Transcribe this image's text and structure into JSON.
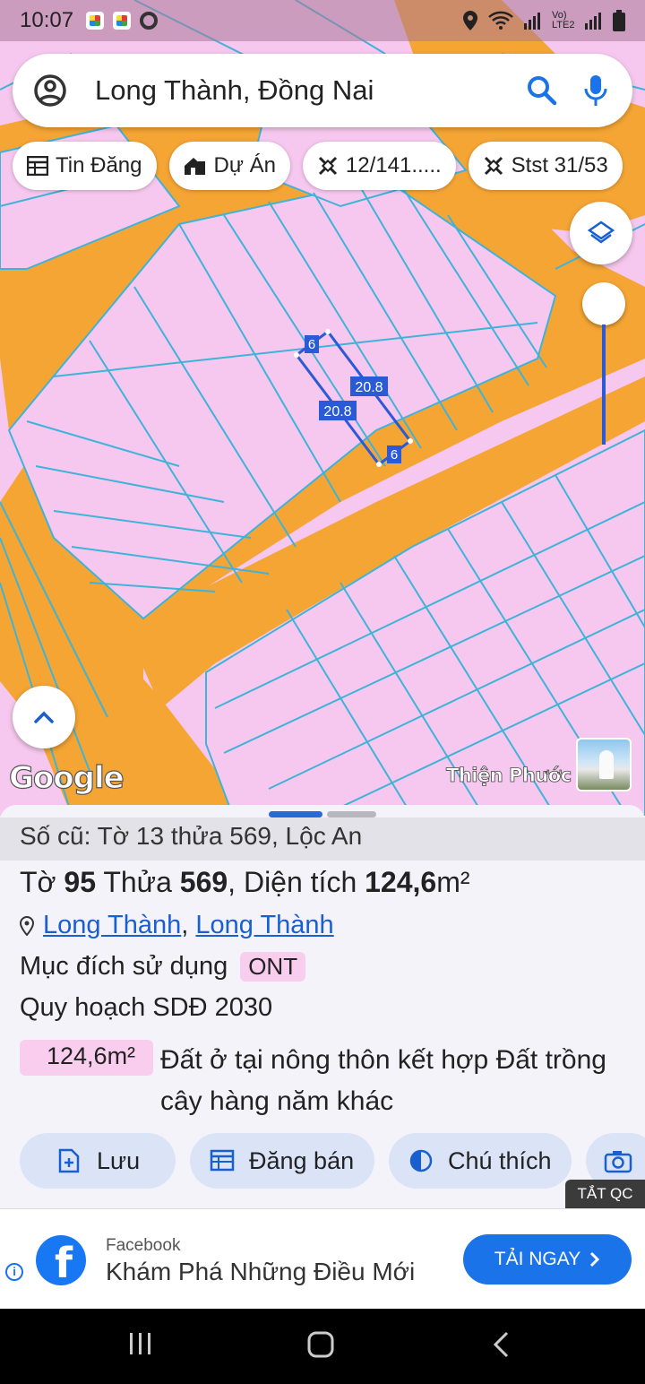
{
  "status_bar": {
    "time": "10:07",
    "carrier": "Vo) LTE2"
  },
  "search": {
    "query": "Long Thành, Đồng Nai"
  },
  "chips": [
    {
      "icon": "table-icon",
      "label": "Tin Đăng"
    },
    {
      "icon": "house-icon",
      "label": "Dự Án"
    },
    {
      "icon": "ruler-icon",
      "label": "12/141....."
    },
    {
      "icon": "ruler-icon",
      "label": "Stst 31/53"
    }
  ],
  "map": {
    "measurements": {
      "short_side": "6",
      "long_side": "20.8"
    },
    "attribution": "Google",
    "place_label": "Thiện Phước"
  },
  "details": {
    "old_reference": "Số cũ: Tờ 13 thửa 569, Lộc An",
    "title_sheet_label": "Tờ",
    "title_sheet": "95",
    "title_parcel_label": "Thửa",
    "title_parcel": "569",
    "title_area_label": "Diện tích",
    "title_area_value": "124,6",
    "title_area_unit": "m²",
    "location": {
      "ward": "Long Thành",
      "district": "Long Thành",
      "separator": ","
    },
    "purpose_label": "Mục đích sử dụng",
    "purpose_code": "ONT",
    "plan_label": "Quy hoạch SDĐ 2030",
    "plan_area": "124,6m²",
    "land_type": "Đất ở tại nông thôn kết hợp Đất trồng cây hàng năm khác"
  },
  "actions": [
    {
      "icon": "bookmark-add-icon",
      "label": "Lưu"
    },
    {
      "icon": "calendar-icon",
      "label": "Đăng bán"
    },
    {
      "icon": "contrast-icon",
      "label": "Chú thích"
    },
    {
      "icon": "camera-icon",
      "label": ""
    }
  ],
  "ad": {
    "close_label": "TẮT QC",
    "source": "Facebook",
    "message": "Khám Phá Những Điều Mới",
    "cta": "TẢI NGAY"
  },
  "colors": {
    "parcel": "#f7c8ef",
    "road": "#f5a534",
    "boundary": "#3fb3d8",
    "accent": "#1a73e8",
    "selection": "#2a5ad6"
  }
}
